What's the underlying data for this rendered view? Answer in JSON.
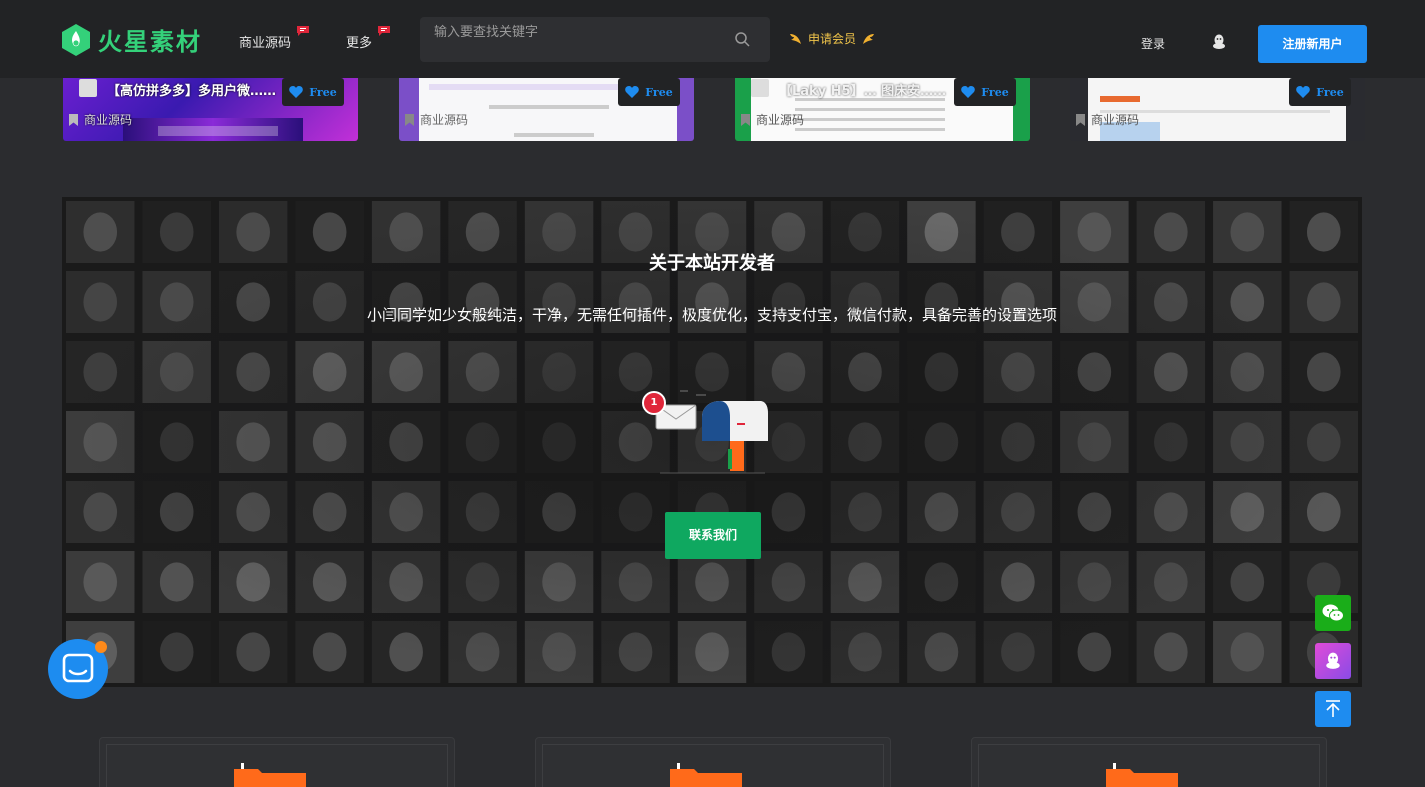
{
  "header": {
    "logo_text": "火星素材",
    "nav": [
      {
        "label": "商业源码"
      },
      {
        "label": "更多"
      }
    ],
    "search_placeholder": "输入要查找关键字",
    "vip_label": "申请会员",
    "login_label": "登录",
    "register_label": "注册新用户"
  },
  "cards": [
    {
      "title": "【高仿拼多多】多用户微……",
      "badge": "Free",
      "category": "商业源码"
    },
    {
      "title": "",
      "badge": "Free",
      "category": "商业源码"
    },
    {
      "title": "【Laky H5】… 图床安……",
      "badge": "Free",
      "category": "商业源码"
    },
    {
      "title": "",
      "badge": "Free",
      "category": "商业源码"
    }
  ],
  "about": {
    "title": "关于本站开发者",
    "description": "小闫同学如少女般纯洁，干净，无需任何插件，极度优化，支持支付宝，微信付款，具备完善的设置选项",
    "notification_count": "1",
    "contact_label": "联系我们"
  },
  "colors": {
    "accent_blue": "#1e8cf0",
    "brand_green": "#34d17a",
    "contact_green": "#0fa860",
    "vip_gold": "#f0c44a",
    "badge_red": "#e0263a",
    "wechat_green": "#1aad19",
    "qq_purple": "#b24de6"
  },
  "icons": {
    "search": "search-icon",
    "vip": "wing-icon",
    "qq": "qq-icon",
    "wechat": "wechat-icon",
    "back_to_top": "arrow-up-icon",
    "chat": "chat-bubble-icon",
    "free": "heart-icon",
    "category": "bookmark-icon"
  }
}
